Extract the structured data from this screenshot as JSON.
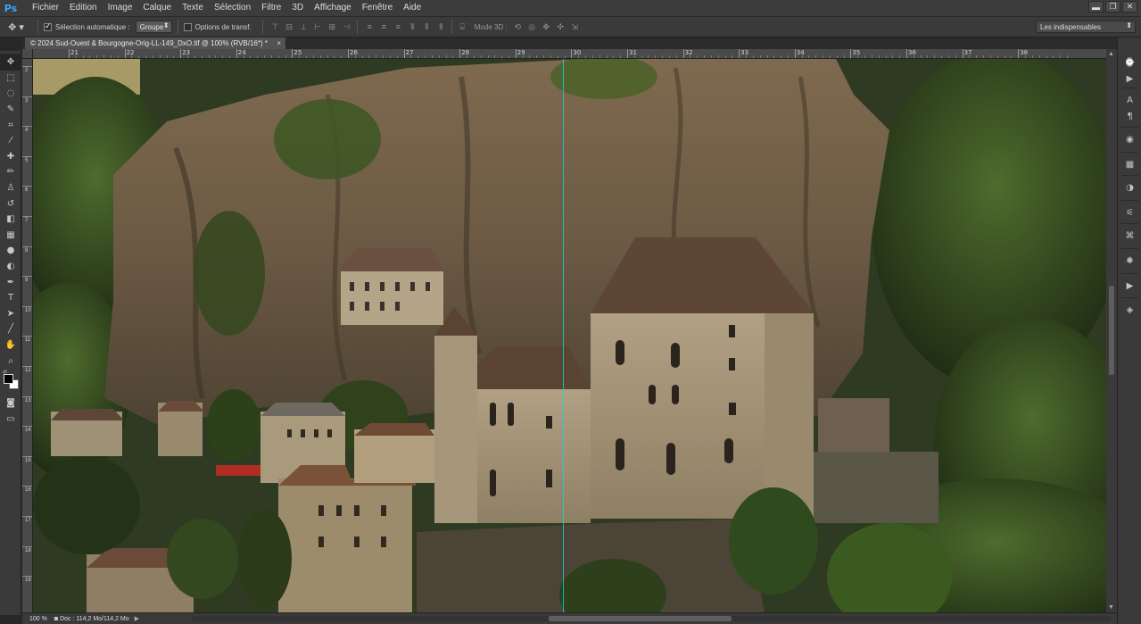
{
  "app": {
    "logo": "Ps"
  },
  "menu": [
    "Fichier",
    "Edition",
    "Image",
    "Calque",
    "Texte",
    "Sélection",
    "Filtre",
    "3D",
    "Affichage",
    "Fenêtre",
    "Aide"
  ],
  "window_controls": {
    "minimize": "▬",
    "restore": "❐",
    "close": "✕"
  },
  "options": {
    "auto_select_label": "Sélection automatique :",
    "auto_select_checked": true,
    "auto_select_value": "Groupe",
    "transform_label": "Options de transf.",
    "transform_checked": false,
    "mode3d_label": "Mode 3D :"
  },
  "workspace": {
    "value": "Les indispensables"
  },
  "document": {
    "tab_title": "© 2024 Sud-Ouest & Bourgogne-Orig-LL-149_DxO.tif @ 100% (RVB/16*) *",
    "close_glyph": "×"
  },
  "ruler": {
    "h_labels": [
      "21",
      "22",
      "23",
      "24",
      "25",
      "26",
      "27",
      "28",
      "29",
      "30",
      "31",
      "32",
      "33",
      "34",
      "35",
      "36",
      "37",
      "38"
    ],
    "v_labels": [
      "2",
      "3",
      "4",
      "5",
      "6",
      "7",
      "8",
      "9",
      "10",
      "11",
      "12",
      "13",
      "14",
      "15",
      "16",
      "17",
      "18",
      "19"
    ]
  },
  "tools": [
    {
      "name": "move-tool-icon",
      "glyph": "✥"
    },
    {
      "name": "marquee-tool-icon",
      "glyph": "⬚"
    },
    {
      "name": "lasso-tool-icon",
      "glyph": "◌"
    },
    {
      "name": "quick-select-tool-icon",
      "glyph": "✎"
    },
    {
      "name": "crop-tool-icon",
      "glyph": "⌗"
    },
    {
      "name": "eyedropper-tool-icon",
      "glyph": "⁄"
    },
    {
      "name": "healing-brush-tool-icon",
      "glyph": "✚"
    },
    {
      "name": "brush-tool-icon",
      "glyph": "✏"
    },
    {
      "name": "clone-stamp-tool-icon",
      "glyph": "♙"
    },
    {
      "name": "history-brush-tool-icon",
      "glyph": "↺"
    },
    {
      "name": "eraser-tool-icon",
      "glyph": "◧"
    },
    {
      "name": "gradient-tool-icon",
      "glyph": "▦"
    },
    {
      "name": "blur-tool-icon",
      "glyph": "●"
    },
    {
      "name": "dodge-tool-icon",
      "glyph": "◐"
    },
    {
      "name": "pen-tool-icon",
      "glyph": "✒"
    },
    {
      "name": "type-tool-icon",
      "glyph": "T"
    },
    {
      "name": "path-select-tool-icon",
      "glyph": "➤"
    },
    {
      "name": "line-tool-icon",
      "glyph": "╱"
    },
    {
      "name": "hand-tool-icon",
      "glyph": "✋"
    },
    {
      "name": "zoom-tool-icon",
      "glyph": "⌕"
    }
  ],
  "status": {
    "zoom": "100 %",
    "doc_info": "Doc : 114,2 Mo/114,2 Mo",
    "arrow": "▶"
  },
  "dock": [
    {
      "name": "history-panel-icon",
      "glyph": "⌚"
    },
    {
      "name": "actions-panel-icon",
      "glyph": "▶"
    },
    {
      "name": "character-panel-icon",
      "glyph": "A"
    },
    {
      "name": "paragraph-panel-icon",
      "glyph": "¶"
    },
    {
      "name": "color-panel-icon",
      "glyph": "◉"
    },
    {
      "name": "swatches-panel-icon",
      "glyph": "▦"
    },
    {
      "name": "adjustments-panel-icon",
      "glyph": "◑"
    },
    {
      "name": "properties-panel-icon",
      "glyph": "⚟"
    },
    {
      "name": "brush-panel-icon",
      "glyph": "⌘"
    },
    {
      "name": "styles-panel-icon",
      "glyph": "✺"
    },
    {
      "name": "timeline-panel-icon",
      "glyph": "▶"
    },
    {
      "name": "layers-panel-icon",
      "glyph": "◈"
    }
  ]
}
